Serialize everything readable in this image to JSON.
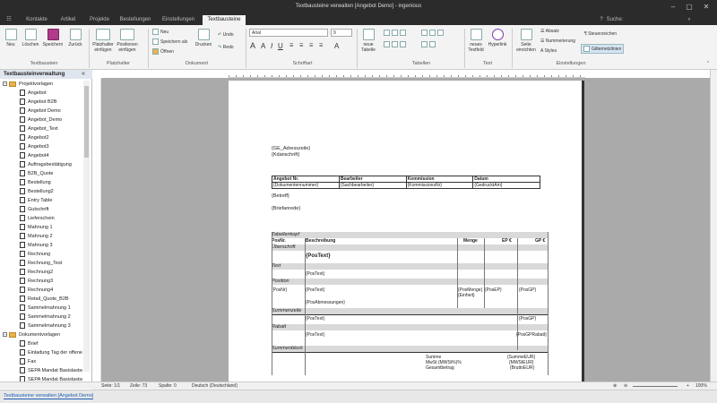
{
  "window": {
    "title": "Textbausteine verwalten [Angebot Demo] - ingenious"
  },
  "tabs": [
    "Kontakte",
    "Artikel",
    "Projekte",
    "Bestellungen",
    "Einstellungen",
    "Textbausteine"
  ],
  "active_tab": "Textbausteine",
  "search": {
    "label": "Suche:",
    "placeholder": ""
  },
  "ribbon": {
    "groups": {
      "textbausteine": "Textbaustein",
      "platzhalter": "Platzhalter",
      "dokument": "Dokument",
      "schriftart": "Schriftart",
      "tabellen": "Tabellen",
      "text": "Text",
      "einstellungen": "Einstellungen"
    },
    "buttons": {
      "neu": "Neu",
      "loeschen": "Löschen",
      "speichern": "Speichern",
      "zurueck": "Zurück",
      "platzhalter_einfuegen": "Platzhalter einfügen",
      "positionen_einfuegen": "Positionen einfügen",
      "doc_neu": "Neu",
      "speichern_als": "Speichern als",
      "oeffnen": "Öffnen",
      "drucken": "Drucken",
      "undo": "Undo",
      "redo": "Redo",
      "font_name": "Arial",
      "font_size": "9",
      "neue_tabelle": "neue Tabelle",
      "neues_textfeld": "neues Textfeld",
      "hyperlink": "Hyperlink",
      "seite_einrichten": "Seite einrichten",
      "absatz": "Absatz",
      "nummerierung": "Nummerierung",
      "styles": "Styles",
      "steuerzeichen": "Steuerzeichen",
      "gitternetzlinien": "Gitternetzlinien"
    }
  },
  "left_panel": {
    "title": "Textbausteinverwaltung",
    "root1": "Projektvorlagen",
    "items1": [
      "Angebot",
      "Angebot B2B",
      "Angebot Demo",
      "Angebot_Demo",
      "Angebot_Text",
      "Angebot2",
      "Angebot3",
      "Angebot4",
      "Auftragsbestätigung",
      "B2B_Quote",
      "Bestellung",
      "Bestellung2",
      "Entry Table",
      "Gutschrift",
      "Lieferschein",
      "Mahnung 1",
      "Mahnung 2",
      "Mahnung 3",
      "Rechnung",
      "Rechnung_Test",
      "Rechnung2",
      "Rechnung3",
      "Rechnung4",
      "Retail_Quote_B2B",
      "Sammelmahnung 1",
      "Sammelmahnung 2",
      "Sammelmahnung 3"
    ],
    "root2": "Dokumentvorlagen",
    "items2": [
      "Brief",
      "Einladung Tag der offenen",
      "Fax",
      "SEPA Mandat Basislastsch",
      "SEPA Mandat Basislastsch"
    ]
  },
  "document": {
    "address1": "{GE_Adresszeile}",
    "address2": "{Kdanschrift}",
    "header_table": {
      "headers": [
        "Angebot Nr.",
        "Bearbeiter",
        "Kommission",
        "Datum"
      ],
      "values": [
        "{Dokumentennummer}",
        "{Sachbearbeiter}",
        "{KommissionsNr}",
        "{GedrucktAm}"
      ]
    },
    "betreff": "{Betreff}",
    "briefanrede": "{Briefanrede}",
    "pos_table": {
      "kopf": "Tabellenkopf",
      "headers": [
        "PosNr.",
        "Beschreibung",
        "Menge",
        "EP €",
        "GP €"
      ],
      "ueberschrift": "Überschrift",
      "postext_bold": "{PosText}",
      "text": "Text",
      "postext": "{PosText}",
      "position": "Position",
      "posnr": "{PosNr}",
      "pos_postext": "{PosText}",
      "posmenge": "{PosMenge}{Einheit}",
      "posep": "{PosEP}",
      "posgp": "{PosGP}",
      "posabmessungen": "{PosAbmessungen}",
      "summenzeile": "Summenzeile",
      "sz_postext": "{PosText}",
      "sz_posgp": "{PosGP}",
      "rabatt": "Rabatt",
      "rb_postext": "{PosText}",
      "rb_posgp": "{PosGPRabatt}",
      "summenblock": "Summenblock",
      "summe_label": "Summe",
      "mwst_label": "MwSt (MWSt%)%",
      "gesamt_label": "Gesamtbetrag",
      "summe_val": "{SummeEUR}",
      "mwst_val": "{MWStEUR}",
      "gesamt_val": "{BruttoEUR}"
    }
  },
  "status": {
    "seite": "Seite: 1/1",
    "zeile": "Zeile: 73",
    "spalte": "Spalte: 0",
    "sprache": "Deutsch (Deutschland)",
    "zoom": "100%"
  },
  "bottom_tab": "Textbausteine verwalten [Angebot Demo]"
}
